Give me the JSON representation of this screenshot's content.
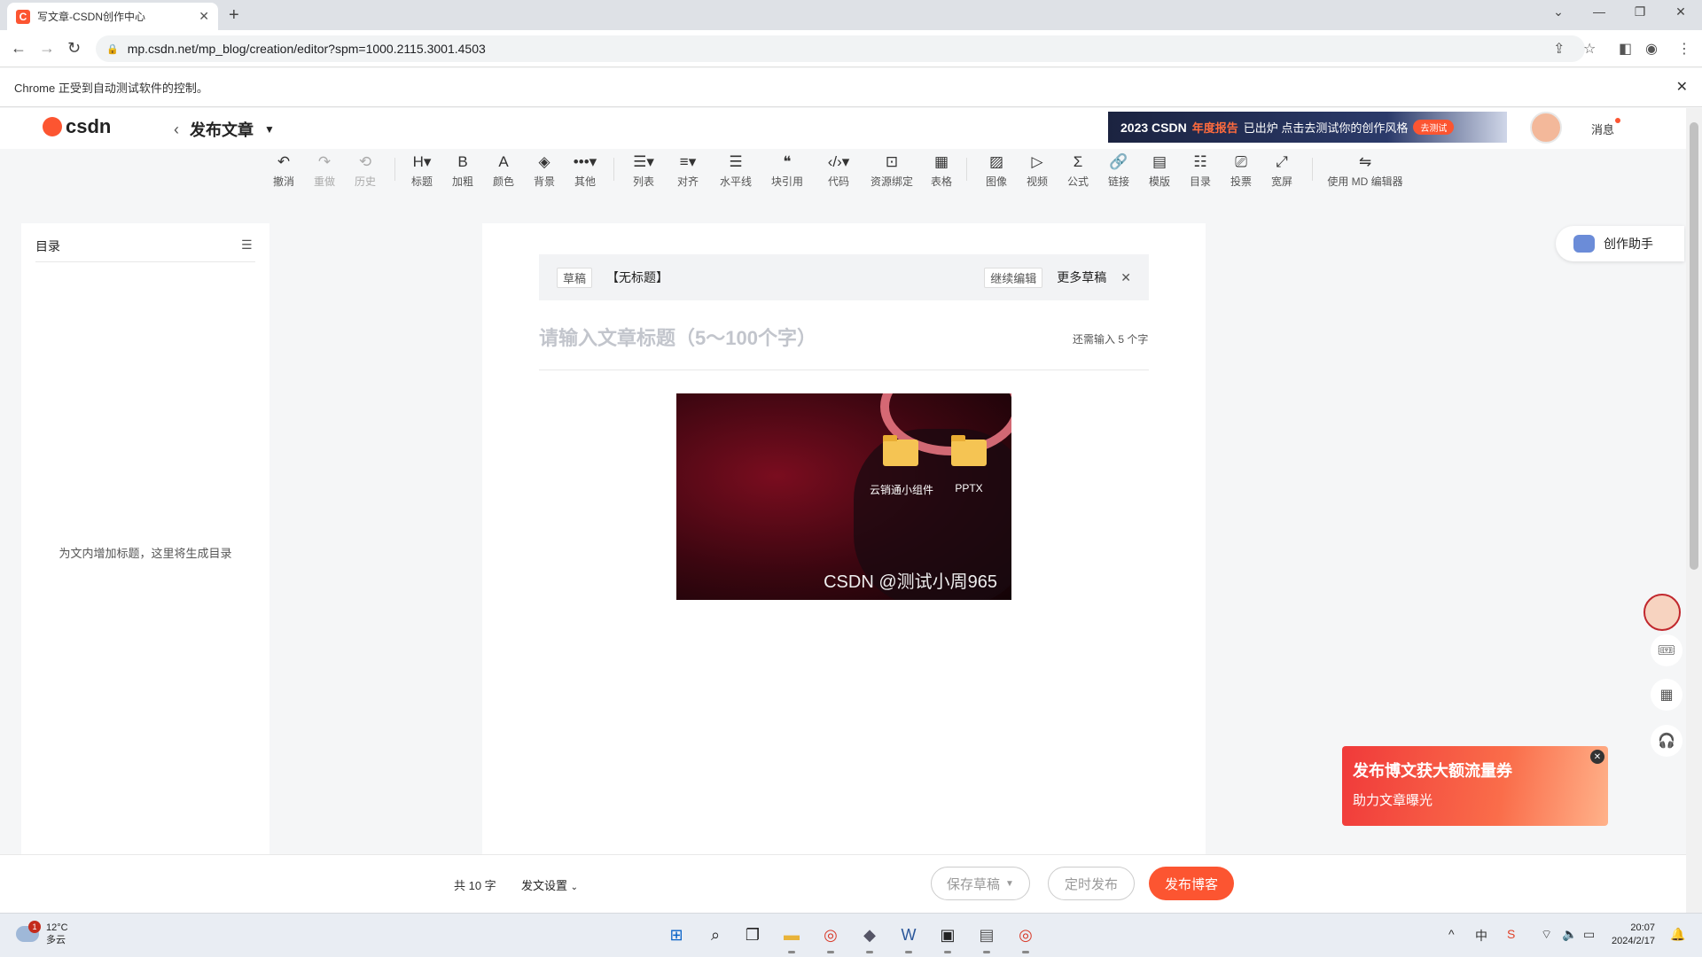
{
  "browser": {
    "tab_title": "写文章-CSDN创作中心",
    "favicon_letter": "C",
    "url": "mp.csdn.net/mp_blog/creation/editor?spm=1000.2115.3001.4503",
    "info_bar": "Chrome 正受到自动测试软件的控制。"
  },
  "header": {
    "logo_text": "csdn",
    "publish_title": "发布文章",
    "banner_year": "2023 CSDN",
    "banner_highlight": "年度报告",
    "banner_text": "已出炉 点击去测试你的创作风格",
    "banner_button": "去测试",
    "messages": "消息"
  },
  "toolbar": [
    {
      "label": "撤消",
      "icon": "undo-icon",
      "glyph": "↶",
      "enabled": true
    },
    {
      "label": "重做",
      "icon": "redo-icon",
      "glyph": "↷",
      "enabled": false
    },
    {
      "label": "历史",
      "icon": "history-icon",
      "glyph": "⟲",
      "enabled": false
    },
    {
      "label": "标题",
      "icon": "heading-icon",
      "glyph": "H▾",
      "enabled": true
    },
    {
      "label": "加粗",
      "icon": "bold-icon",
      "glyph": "B",
      "enabled": true
    },
    {
      "label": "颜色",
      "icon": "font-color-icon",
      "glyph": "A",
      "enabled": true
    },
    {
      "label": "背景",
      "icon": "background-icon",
      "glyph": "◈",
      "enabled": true
    },
    {
      "label": "其他",
      "icon": "more-icon",
      "glyph": "•••▾",
      "enabled": true
    },
    {
      "label": "列表",
      "icon": "list-icon",
      "glyph": "☰▾",
      "enabled": true
    },
    {
      "label": "对齐",
      "icon": "align-icon",
      "glyph": "≡▾",
      "enabled": true
    },
    {
      "label": "水平线",
      "icon": "horizontal-rule-icon",
      "glyph": "☰",
      "enabled": true
    },
    {
      "label": "块引用",
      "icon": "quote-icon",
      "glyph": "❝",
      "enabled": true
    },
    {
      "label": "代码",
      "icon": "code-icon",
      "glyph": "‹/›▾",
      "enabled": true
    },
    {
      "label": "资源绑定",
      "icon": "resource-icon",
      "glyph": "⊡",
      "enabled": true
    },
    {
      "label": "表格",
      "icon": "table-icon",
      "glyph": "▦",
      "enabled": true
    },
    {
      "label": "图像",
      "icon": "image-icon",
      "glyph": "▨",
      "enabled": true
    },
    {
      "label": "视频",
      "icon": "video-icon",
      "glyph": "▷",
      "enabled": true
    },
    {
      "label": "公式",
      "icon": "formula-icon",
      "glyph": "Σ",
      "enabled": true
    },
    {
      "label": "链接",
      "icon": "link-icon",
      "glyph": "🔗",
      "enabled": true
    },
    {
      "label": "模版",
      "icon": "template-icon",
      "glyph": "▤",
      "enabled": true
    },
    {
      "label": "目录",
      "icon": "toc-icon",
      "glyph": "☷",
      "enabled": true
    },
    {
      "label": "投票",
      "icon": "vote-icon",
      "glyph": "⎚",
      "enabled": true
    },
    {
      "label": "宽屏",
      "icon": "widescreen-icon",
      "glyph": "⤢",
      "enabled": true
    },
    {
      "label": "使用 MD 编辑器",
      "icon": "md-editor-icon",
      "glyph": "⇋",
      "enabled": true
    }
  ],
  "toc": {
    "heading": "目录",
    "empty_hint": "为文内增加标题，这里将生成目录"
  },
  "draft": {
    "badge": "草稿",
    "title": "【无标题】",
    "continue": "继续编辑",
    "more": "更多草稿"
  },
  "editor": {
    "title_placeholder": "请输入文章标题（5～100个字）",
    "title_counter": "还需输入 5 个字",
    "image": {
      "folder1_label": "云销通小组件",
      "folder2_label": "PPTX",
      "watermark": "CSDN @测试小周965"
    }
  },
  "side": {
    "assistant": "创作助手"
  },
  "promo": {
    "title": "发布博文获大额流量券",
    "subtitle": "助力文章曝光"
  },
  "footer": {
    "word_count": "共 10 字",
    "settings": "发文设置",
    "save_draft": "保存草稿",
    "schedule": "定时发布",
    "publish": "发布博客"
  },
  "taskbar": {
    "temperature": "12°C",
    "weather": "多云",
    "weather_badge": "1",
    "time": "20:07",
    "date": "2024/2/17"
  },
  "colors": {
    "brand": "#fc5531",
    "page_bg": "#f5f6f7"
  }
}
